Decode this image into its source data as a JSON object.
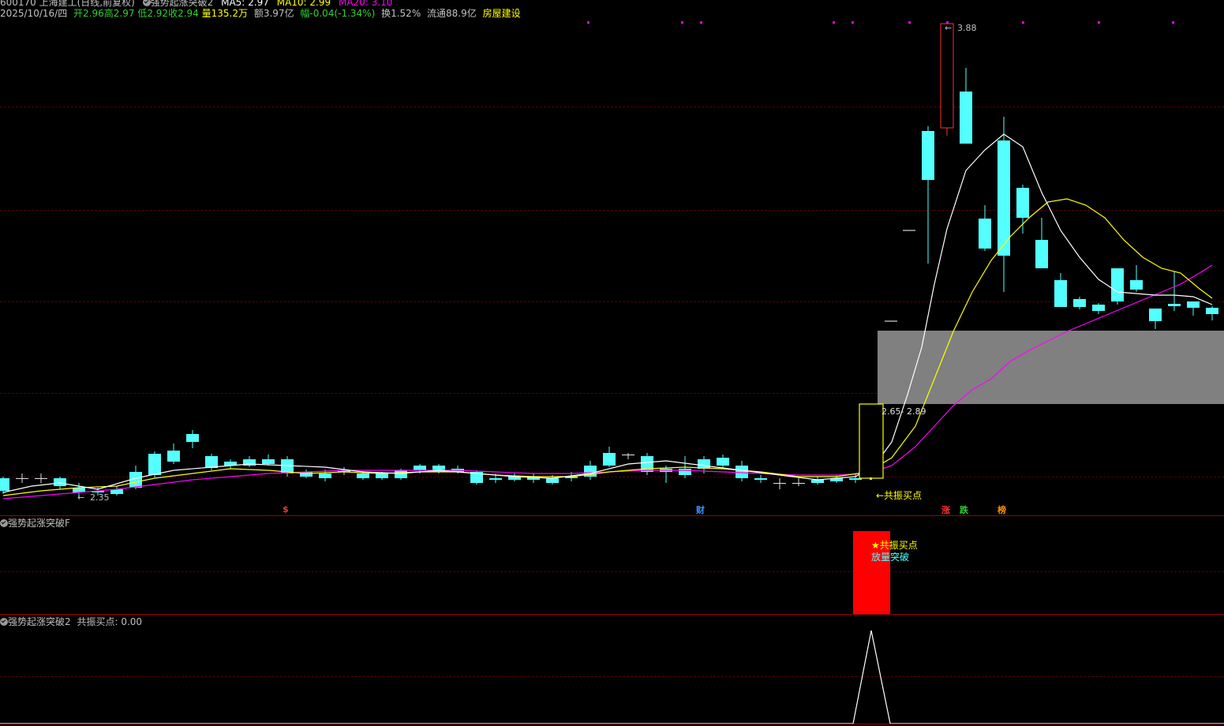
{
  "header": {
    "line1": {
      "code_name": "600170 上海建工(日线,前复权)",
      "indicator": "强势起涨突破2",
      "ma5": "MA5: 2.97",
      "ma10": "MA10: 2.99",
      "ma20": "MA20: 3.10"
    },
    "line2": {
      "date": "2025/10/16/四",
      "open": "开2.96",
      "high": "高2.97",
      "low": "低2.92",
      "close": "收2.94",
      "volume": "量135.2万",
      "amount": "额3.97亿",
      "change": "幅-0.04(-1.34%)",
      "turnover": "换1.52%",
      "float": "流通88.9亿",
      "sector": "房屋建设"
    }
  },
  "main_chart": {
    "high_label": "3.88",
    "low_label": "2.35",
    "zone_label": "2.65- 2.89",
    "signal_label": "←共振买点",
    "markers": [
      {
        "label": "$",
        "color": "#ff3030"
      },
      {
        "label": "财",
        "color": "#4090ff"
      },
      {
        "label": "涨",
        "color": "#ff3030"
      },
      {
        "label": "跌",
        "color": "#30d030"
      },
      {
        "label": "榜",
        "color": "#ff9000"
      }
    ],
    "colors": {
      "up": "#ff3030",
      "down": "#54ffff",
      "ma5": "#ffffff",
      "ma10": "#ffff00",
      "ma20": "#ff00ff",
      "zone": "#808080",
      "signal": "#ffff00"
    }
  },
  "panel_f": {
    "title": "强势起涨突破F",
    "label1": "★共振买点",
    "label2": "放量突破"
  },
  "panel_2": {
    "title": "强势起涨突破2",
    "value_label": "共振买点: 0.00"
  }
}
